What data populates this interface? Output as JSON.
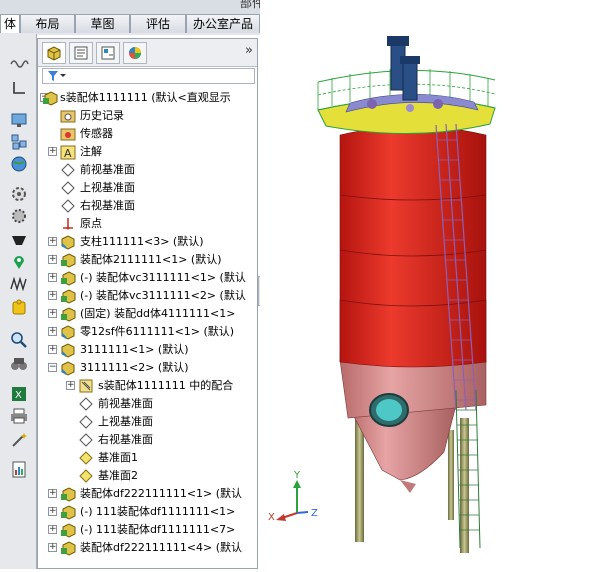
{
  "tabs": [
    "体",
    "布局",
    "草图",
    "评估",
    "办公室产品"
  ],
  "top_hidden_tab": "部件",
  "feature_tree": {
    "root": "s装配体1111111 (默认<直观显示",
    "items": [
      "历史记录",
      "传感器",
      "注解",
      "前视基准面",
      "上视基准面",
      "右视基准面",
      "原点",
      "支柱111111<3> (默认)",
      "装配体2111111<1> (默认)",
      "(-) 装配体vc3111111<1> (默认",
      "(-) 装配体vc3111111<2> (默认",
      "(固定) 装配dd体4111111<1>",
      "零12sf件6111111<1> (默认)",
      "3111111<1> (默认)",
      "3111111<2> (默认)",
      "s装配体1111111 中的配合",
      "前视基准面",
      "上视基准面",
      "右视基准面",
      "基准面1",
      "基准面2",
      "装配体df222111111<1> (默认",
      "(-) 111装配体df1111111<1>",
      "(-) 111装配体df1111111<7>",
      "装配体df222111111<4> (默认"
    ]
  },
  "triad": {
    "x_label": "X",
    "y_label": "Y",
    "z_label": "Z"
  },
  "colors": {
    "shell_red": "#d8231b",
    "cone_pink": "#d98a8a",
    "deck_yellow": "#e5df3a",
    "rail_green": "#2aa33a",
    "ladder_purple": "#8f5fb3"
  }
}
